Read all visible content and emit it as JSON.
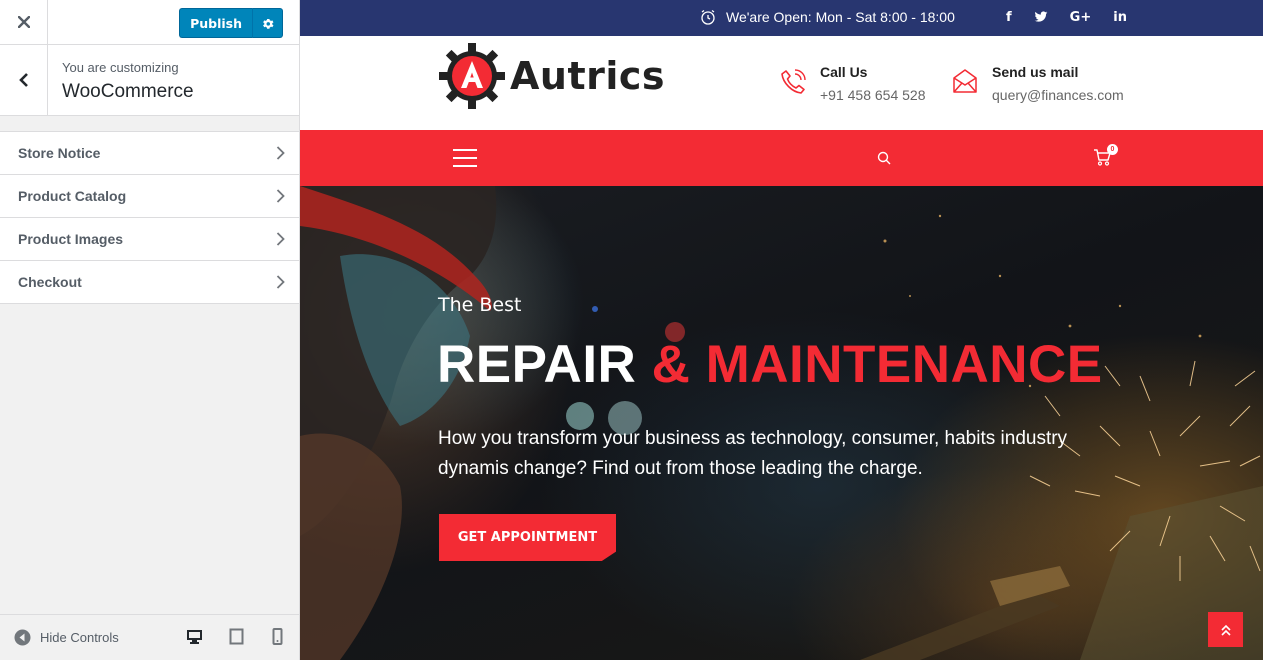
{
  "customizer": {
    "publish_label": "Publish",
    "customizing_label": "You are customizing",
    "section_name": "WooCommerce",
    "menu": [
      {
        "label": "Store Notice"
      },
      {
        "label": "Product Catalog"
      },
      {
        "label": "Product Images"
      },
      {
        "label": "Checkout"
      }
    ],
    "hide_controls_label": "Hide Controls",
    "colors": {
      "publish": "#0085ba"
    }
  },
  "site": {
    "topbar": {
      "hours": "We'are Open: Mon - Sat 8:00 - 18:00",
      "socials": [
        "f",
        "t",
        "G+",
        "in"
      ]
    },
    "logo_text": "Autrics",
    "contacts": [
      {
        "title": "Call Us",
        "value": "+91 458 654 528",
        "icon": "phone-icon"
      },
      {
        "title": "Send us mail",
        "value": "query@finances.com",
        "icon": "mail-icon"
      }
    ],
    "cart_count": "0",
    "hero": {
      "kicker": "The Best",
      "title_main": "REPAIR",
      "title_accent": "& MAINTENANCE",
      "description": "How you transform your business as technology, consumer, habits industry dynamis change? Find out from those leading the charge.",
      "cta": "GET APPOINTMENT"
    },
    "colors": {
      "topbar": "#283670",
      "accent": "#f32b34"
    }
  }
}
